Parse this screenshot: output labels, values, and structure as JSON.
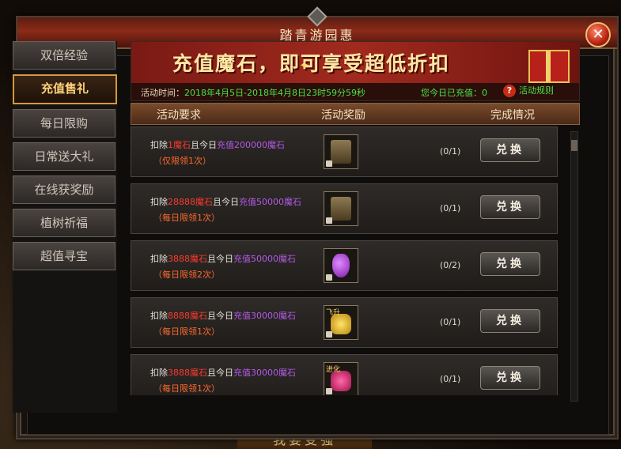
{
  "window": {
    "title": "踏青游园惠",
    "close_symbol": "✕"
  },
  "bottom_hint": "我要变强",
  "sidebar": {
    "items": [
      {
        "label": "双倍经验",
        "active": false
      },
      {
        "label": "充值售礼",
        "active": true
      },
      {
        "label": "每日限购",
        "active": false
      },
      {
        "label": "日常送大礼",
        "active": false
      },
      {
        "label": "在线获奖励",
        "active": false
      },
      {
        "label": "植树祈福",
        "active": false
      },
      {
        "label": "超值寻宝",
        "active": false
      }
    ]
  },
  "banner": {
    "title": "充值魔石，即可享受超低折扣",
    "time_label": "活动时间：",
    "time_value": "2018年4月5日-2018年4月8日23时59分59秒",
    "recharge_label": "您今日已充值：0",
    "rules_label": "活动规则",
    "rules_icon": "?"
  },
  "columns": {
    "requirement": "活动要求",
    "reward": "活动奖励",
    "status": "完成情况"
  },
  "rows": [
    {
      "pre": "扣除",
      "cost": "1魔石",
      "mid": "且今日",
      "charge": "充值200000魔石",
      "limit": "（仅限领1次）",
      "progress": "(0/1)",
      "button": "兑换",
      "item": "badge",
      "tag": ""
    },
    {
      "pre": "扣除",
      "cost": "28888魔石",
      "mid": "且今日",
      "charge": "充值50000魔石",
      "limit": "（每日限领1次）",
      "progress": "(0/1)",
      "button": "兑换",
      "item": "badge",
      "tag": ""
    },
    {
      "pre": "扣除",
      "cost": "3888魔石",
      "mid": "且今日",
      "charge": "充值50000魔石",
      "limit": "（每日限领2次）",
      "progress": "(0/2)",
      "button": "兑换",
      "item": "purple",
      "tag": ""
    },
    {
      "pre": "扣除",
      "cost": "8888魔石",
      "mid": "且今日",
      "charge": "充值30000魔石",
      "limit": "（每日限领1次）",
      "progress": "(0/1)",
      "button": "兑换",
      "item": "gold",
      "tag": "飞升"
    },
    {
      "pre": "扣除",
      "cost": "3888魔石",
      "mid": "且今日",
      "charge": "充值30000魔石",
      "limit": "（每日限领1次）",
      "progress": "(0/1)",
      "button": "兑换",
      "item": "pink",
      "tag": "进化"
    }
  ]
}
